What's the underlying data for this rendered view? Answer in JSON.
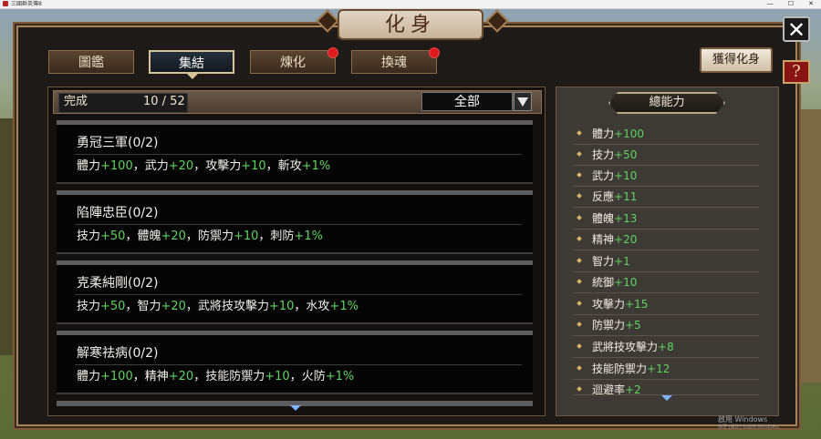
{
  "window": {
    "title": "三國群英傳8",
    "controls": [
      "—",
      "☐",
      "✕"
    ]
  },
  "header": {
    "title": "化身",
    "close_icon": "close-icon",
    "help_label": "?"
  },
  "tabs": [
    {
      "label": "圖鑑",
      "active": false,
      "alert": false
    },
    {
      "label": "集結",
      "active": true,
      "alert": false
    },
    {
      "label": "煉化",
      "active": false,
      "alert": true
    },
    {
      "label": "換魂",
      "active": false,
      "alert": true
    }
  ],
  "obtain_button": {
    "label": "獲得化身"
  },
  "list": {
    "progress_label": "完成",
    "progress_count": "10 / 52",
    "filter_value": "全部",
    "cards": [
      {
        "title": "勇冠三軍(0/2)",
        "stats": [
          {
            "name": "體力",
            "bonus": "+100"
          },
          {
            "name": "武力",
            "bonus": "+20"
          },
          {
            "name": "攻擊力",
            "bonus": "+10"
          },
          {
            "name": "斬攻",
            "bonus": "+1%"
          }
        ]
      },
      {
        "title": "陷陣忠臣(0/2)",
        "stats": [
          {
            "name": "技力",
            "bonus": "+50"
          },
          {
            "name": "體魄",
            "bonus": "+20"
          },
          {
            "name": "防禦力",
            "bonus": "+10"
          },
          {
            "name": "刺防",
            "bonus": "+1%"
          }
        ]
      },
      {
        "title": "克柔純剛(0/2)",
        "stats": [
          {
            "name": "技力",
            "bonus": "+50"
          },
          {
            "name": "智力",
            "bonus": "+20"
          },
          {
            "name": "武將技攻擊力",
            "bonus": "+10"
          },
          {
            "name": "水攻",
            "bonus": "+1%"
          }
        ]
      },
      {
        "title": "解寒祛病(0/2)",
        "stats": [
          {
            "name": "體力",
            "bonus": "+100"
          },
          {
            "name": "精神",
            "bonus": "+20"
          },
          {
            "name": "技能防禦力",
            "bonus": "+10"
          },
          {
            "name": "火防",
            "bonus": "+1%"
          }
        ]
      }
    ]
  },
  "summary": {
    "title": "總能力",
    "rows": [
      {
        "name": "體力",
        "bonus": "+100"
      },
      {
        "name": "技力",
        "bonus": "+50"
      },
      {
        "name": "武力",
        "bonus": "+10"
      },
      {
        "name": "反應",
        "bonus": "+11"
      },
      {
        "name": "體魄",
        "bonus": "+13"
      },
      {
        "name": "精神",
        "bonus": "+20"
      },
      {
        "name": "智力",
        "bonus": "+1"
      },
      {
        "name": "統御",
        "bonus": "+10"
      },
      {
        "name": "攻擊力",
        "bonus": "+15"
      },
      {
        "name": "防禦力",
        "bonus": "+5"
      },
      {
        "name": "武將技攻擊力",
        "bonus": "+8"
      },
      {
        "name": "技能防禦力",
        "bonus": "+12"
      },
      {
        "name": "迴避率",
        "bonus": "+2"
      }
    ]
  },
  "watermark": {
    "line1": "啟用 Windows",
    "line2": "移至 [設定] 以啟用 Windows。"
  },
  "colors": {
    "bonus_green": "#5fd35f",
    "alert_red": "#e01b1b",
    "frame_gold": "#a6845a"
  }
}
